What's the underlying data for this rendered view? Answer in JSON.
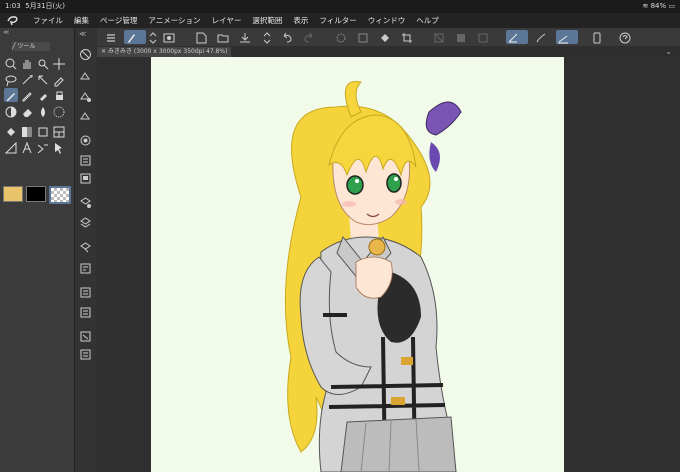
{
  "status": {
    "time": "1:03",
    "date": "5月31日(火)",
    "battery": "84%"
  },
  "menu": [
    "ファイル",
    "編集",
    "ページ管理",
    "アニメーション",
    "レイヤー",
    "選択範囲",
    "表示",
    "フィルター",
    "ウィンドウ",
    "ヘルプ"
  ],
  "panel": {
    "header": "≪",
    "tool_tab_label": "ツール"
  },
  "document": {
    "tab_label": "みきみき (3000 x 3000px 350dpi 47.8%)"
  },
  "colors": {
    "main": "#e9c46a",
    "sub": "#000000",
    "accent": "#5b7696",
    "canvas_bg": "#f2fbe9"
  },
  "toolbar_icons": [
    "menu-icon",
    "pen-mode-icon",
    "stepper-icon",
    "screen-icon",
    "new-file-icon",
    "open-file-icon",
    "save-icon",
    "export-icon",
    "stepper-icon",
    "undo-icon",
    "redo-icon",
    "settings-icon",
    "transform-icon",
    "fill-icon",
    "crop-icon",
    "layer-a-icon",
    "layer-b-icon",
    "layer-c-icon",
    "ruler-icon",
    "brush-icon",
    "line-icon",
    "device-icon",
    "help-icon"
  ],
  "left_tools": [
    "magnifier-icon",
    "hand-icon",
    "zoom-move-icon",
    "move-icon",
    "lasso-icon",
    "magic-wand-icon",
    "move-layer-icon",
    "eyedropper-icon",
    "pen-icon",
    "pencil-icon",
    "airbrush-icon",
    "marker-icon",
    "blend-icon",
    "eraser-icon",
    "drop-icon",
    "tone-icon",
    "fill-icon",
    "gradient-icon",
    "shape-icon",
    "frame-icon",
    "ruler-icon",
    "text-icon",
    "balloon-icon",
    "operation-icon"
  ],
  "mid_tools": [
    "no-icon",
    "layer-add-icon",
    "layer-move-icon",
    "layer-edit-icon",
    "layer-setting-icon",
    "history-icon",
    "page-icon",
    "layer-list-icon",
    "material-icon",
    "stack-icon",
    "export-layer-icon",
    "panel-a-icon",
    "panel-b-icon",
    "panel-c-icon",
    "panel-d-icon",
    "panel-e-icon",
    "panel-f-icon"
  ]
}
